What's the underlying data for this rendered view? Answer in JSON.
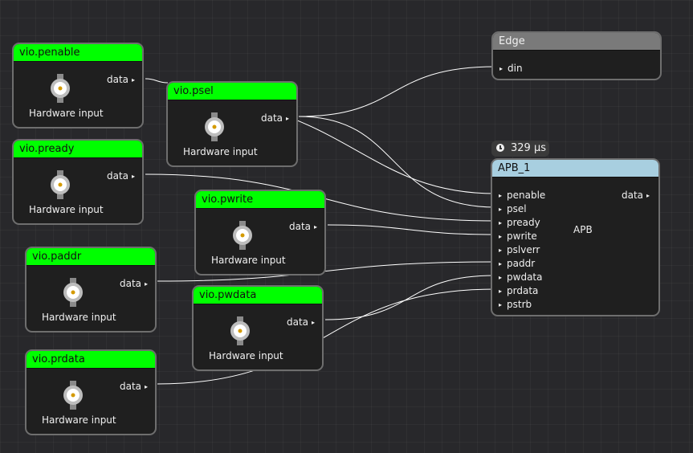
{
  "vio_nodes": [
    {
      "title": "vio.penable",
      "port": "data",
      "label": "Hardware input"
    },
    {
      "title": "vio.psel",
      "port": "data",
      "label": "Hardware input"
    },
    {
      "title": "vio.pready",
      "port": "data",
      "label": "Hardware input"
    },
    {
      "title": "vio.pwrite",
      "port": "data",
      "label": "Hardware input"
    },
    {
      "title": "vio.paddr",
      "port": "data",
      "label": "Hardware input"
    },
    {
      "title": "vio.pwdata",
      "port": "data",
      "label": "Hardware input"
    },
    {
      "title": "vio.prdata",
      "port": "data",
      "label": "Hardware input"
    }
  ],
  "edge": {
    "title": "Edge",
    "input": "din"
  },
  "apb": {
    "time": "329 µs",
    "title": "APB_1",
    "body_label": "APB",
    "output": "data",
    "inputs": [
      "penable",
      "psel",
      "pready",
      "pwrite",
      "pslverr",
      "paddr",
      "pwdata",
      "prdata",
      "pstrb"
    ]
  },
  "colors": {
    "vio_header": "#00ff00",
    "edge_header": "#7a7a7a",
    "apb_header": "#a8cfe0",
    "wire": "#ffffff",
    "background": "#28282b"
  },
  "icons": {
    "connector": "bnc-connector-icon",
    "clock": "clock-icon",
    "port": "triangle-port-icon"
  }
}
